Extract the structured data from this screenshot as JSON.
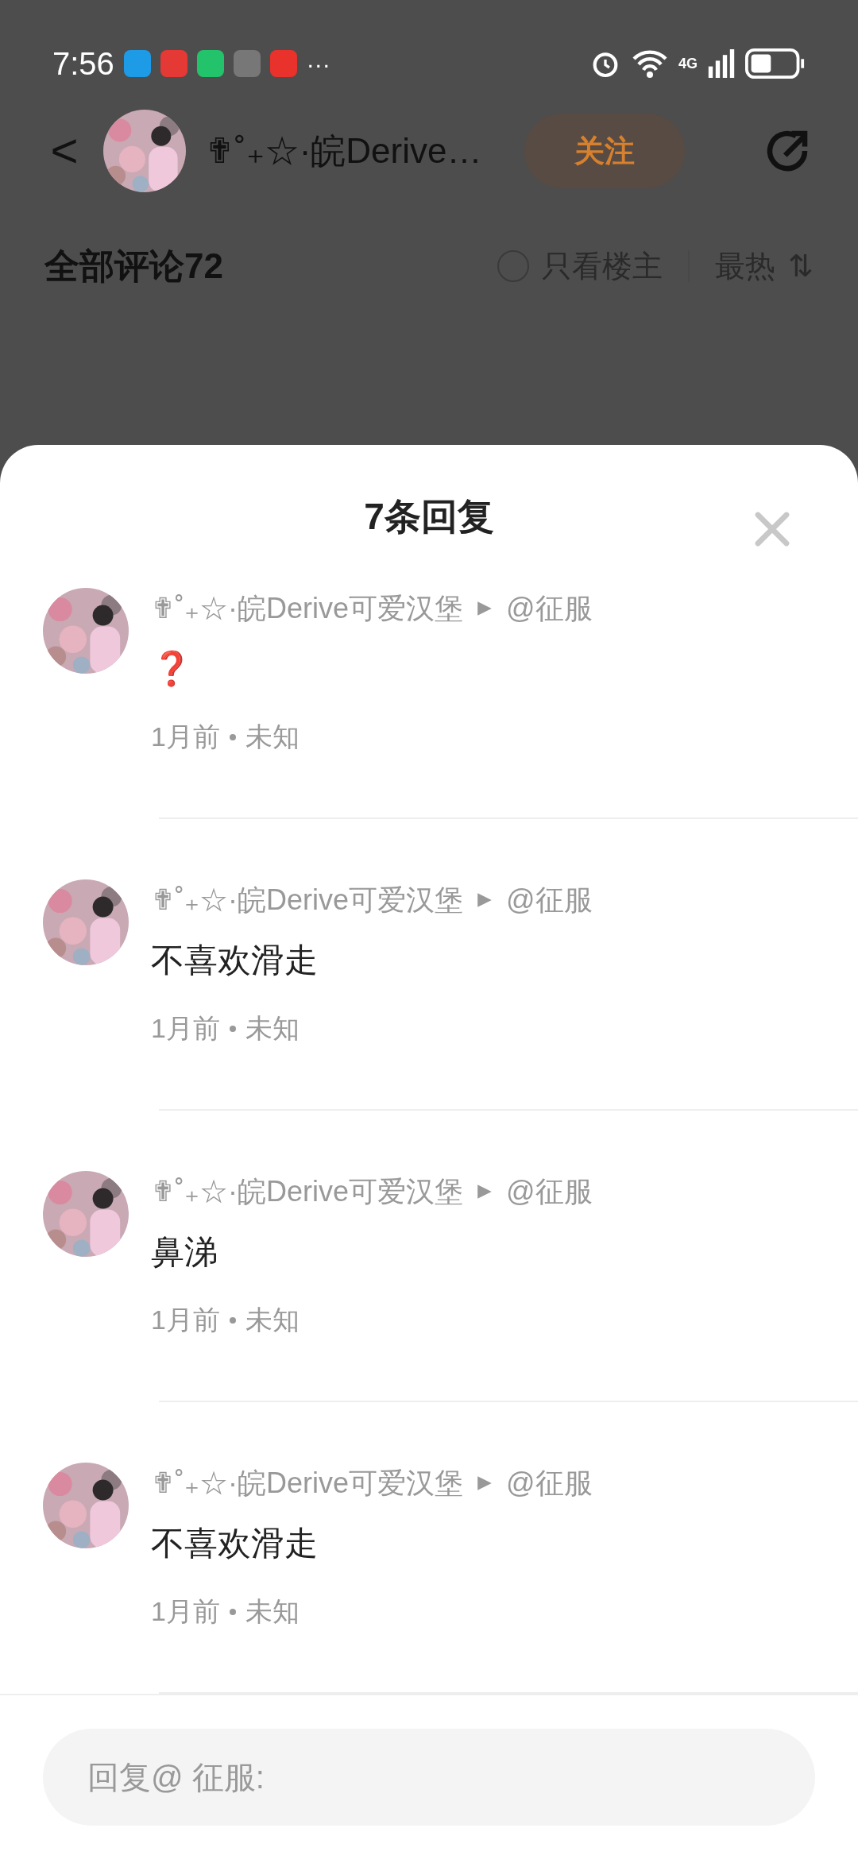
{
  "status_bar": {
    "time": "7:56",
    "more": "···",
    "network": "4G"
  },
  "header": {
    "back": "<",
    "author": "✟˚₊☆·皖Derive…",
    "follow": "关注"
  },
  "comments_bar": {
    "title": "全部评论72",
    "only_author": {
      "label": "只看楼主",
      "checked": false
    },
    "sort": "最热",
    "sort_icon": "⇅"
  },
  "sheet": {
    "title": "7条回复",
    "replies": [
      {
        "author": "✟˚₊☆·皖Derive可爱汉堡",
        "reply_to": "@征服",
        "text": "❓",
        "time": "1月前",
        "location": "未知"
      },
      {
        "author": "✟˚₊☆·皖Derive可爱汉堡",
        "reply_to": "@征服",
        "text": "不喜欢滑走",
        "time": "1月前",
        "location": "未知"
      },
      {
        "author": "✟˚₊☆·皖Derive可爱汉堡",
        "reply_to": "@征服",
        "text": "鼻涕",
        "time": "1月前",
        "location": "未知"
      },
      {
        "author": "✟˚₊☆·皖Derive可爱汉堡",
        "reply_to": "@征服",
        "text": "不喜欢滑走",
        "time": "1月前",
        "location": "未知"
      }
    ],
    "input": {
      "placeholder": "回复@ 征服:"
    }
  }
}
